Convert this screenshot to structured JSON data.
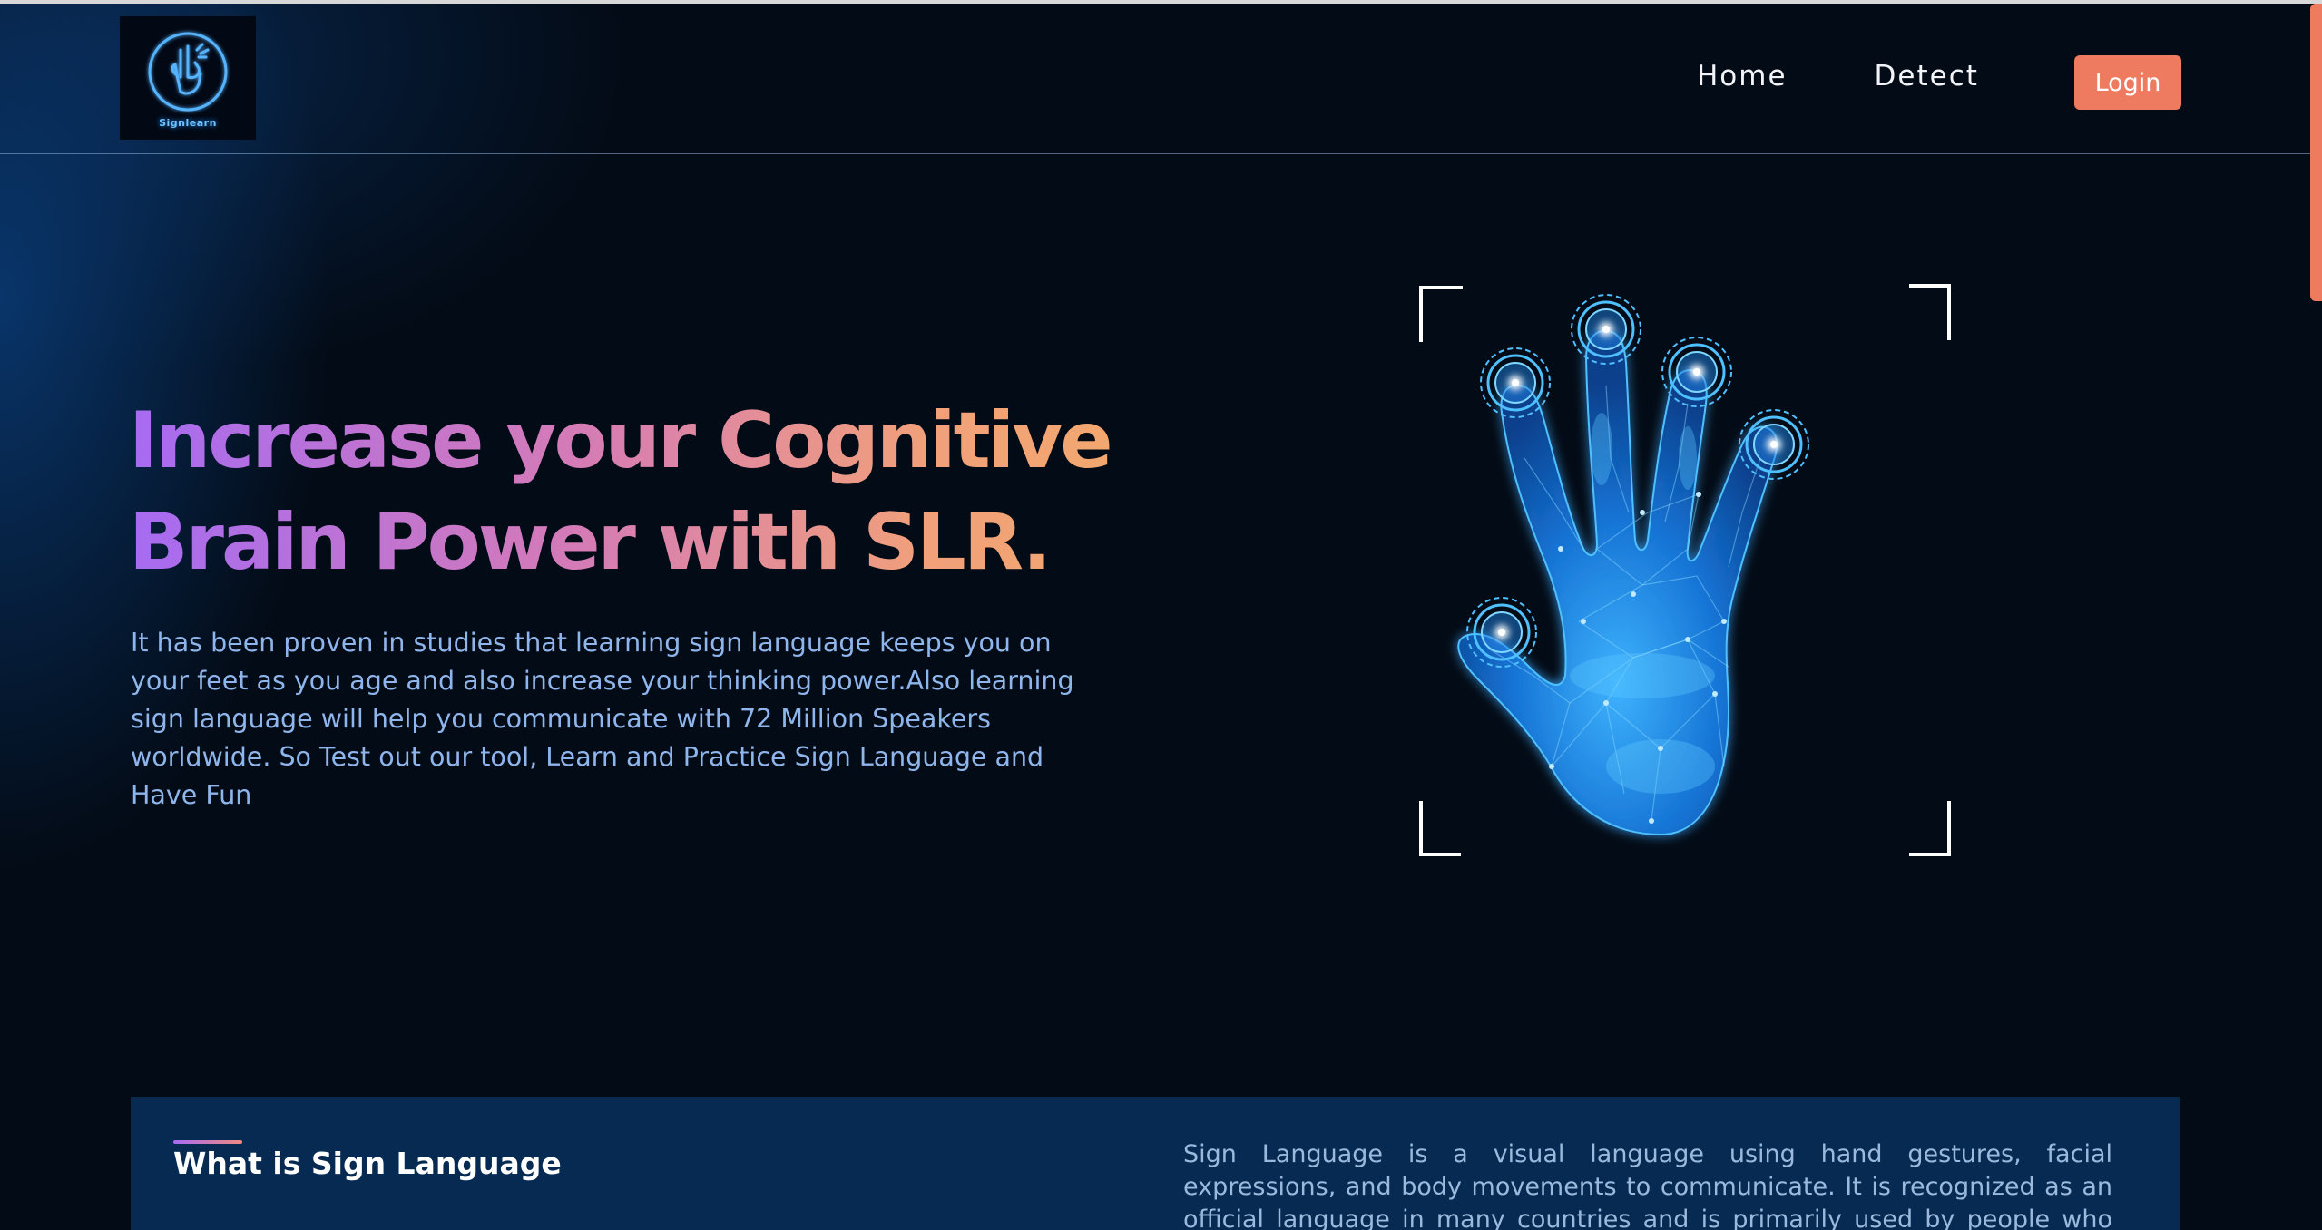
{
  "header": {
    "logo_text": "Signlearn",
    "nav": [
      {
        "label": "Home"
      },
      {
        "label": "Detect"
      }
    ],
    "login_label": "Login"
  },
  "hero": {
    "title_line1": "Increase your Cognitive",
    "title_line2": "Brain Power with SLR.",
    "description": "It has been proven in studies that learning sign language keeps you on your feet as you age and also increase your thinking power.Also learning sign language will help you communicate with 72 Million Speakers worldwide. So Test out our tool, Learn and Practice Sign Language and Have Fun"
  },
  "info": {
    "title": "What is Sign Language",
    "text": "Sign Language is a visual language using hand gestures, facial expressions, and body movements to communicate. It is recognized as an official language in many countries and is primarily used by people who are deaf or"
  },
  "colors": {
    "background": "#030b16",
    "accent": "#ee7a5f",
    "gradient_start": "#a66bf2",
    "gradient_end": "#f2a86e",
    "card": "#062a52",
    "hand_glow": "#1e90ff"
  },
  "icons": {
    "logo": "hand-sign-icon",
    "hero_image": "scanned-hand-icon"
  }
}
